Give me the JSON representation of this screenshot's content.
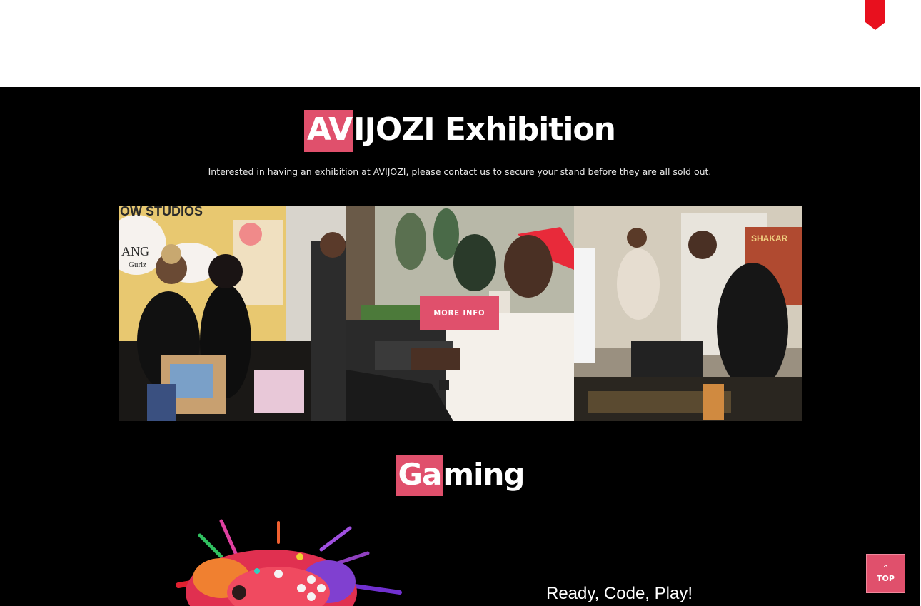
{
  "exhibition": {
    "title_highlight": "AV",
    "title_rest": "IJOZI Exhibition",
    "intro": "Interested in having an exhibition at AVIJOZI, please contact us to secure your stand before they are all sold out.",
    "more_info_label": "MORE INFO",
    "photo_sign_text": "OW STUDIOS",
    "photo_board_text": "ANG",
    "photo_board_sub": "Gurlz",
    "photo_poster_text": "SHAKAR"
  },
  "gaming": {
    "title_highlight": "Ga",
    "title_rest": "ming",
    "tagline": "Ready, Code, Play!"
  },
  "back_to_top": {
    "arrow": "⌃",
    "label": "TOP"
  },
  "colors": {
    "accent": "#e0506c",
    "background": "#000000",
    "header": "#ffffff",
    "bookmark": "#e8101e"
  },
  "icons": {
    "bookmark": "bookmark-icon",
    "back_to_top": "chevron-up-icon"
  }
}
